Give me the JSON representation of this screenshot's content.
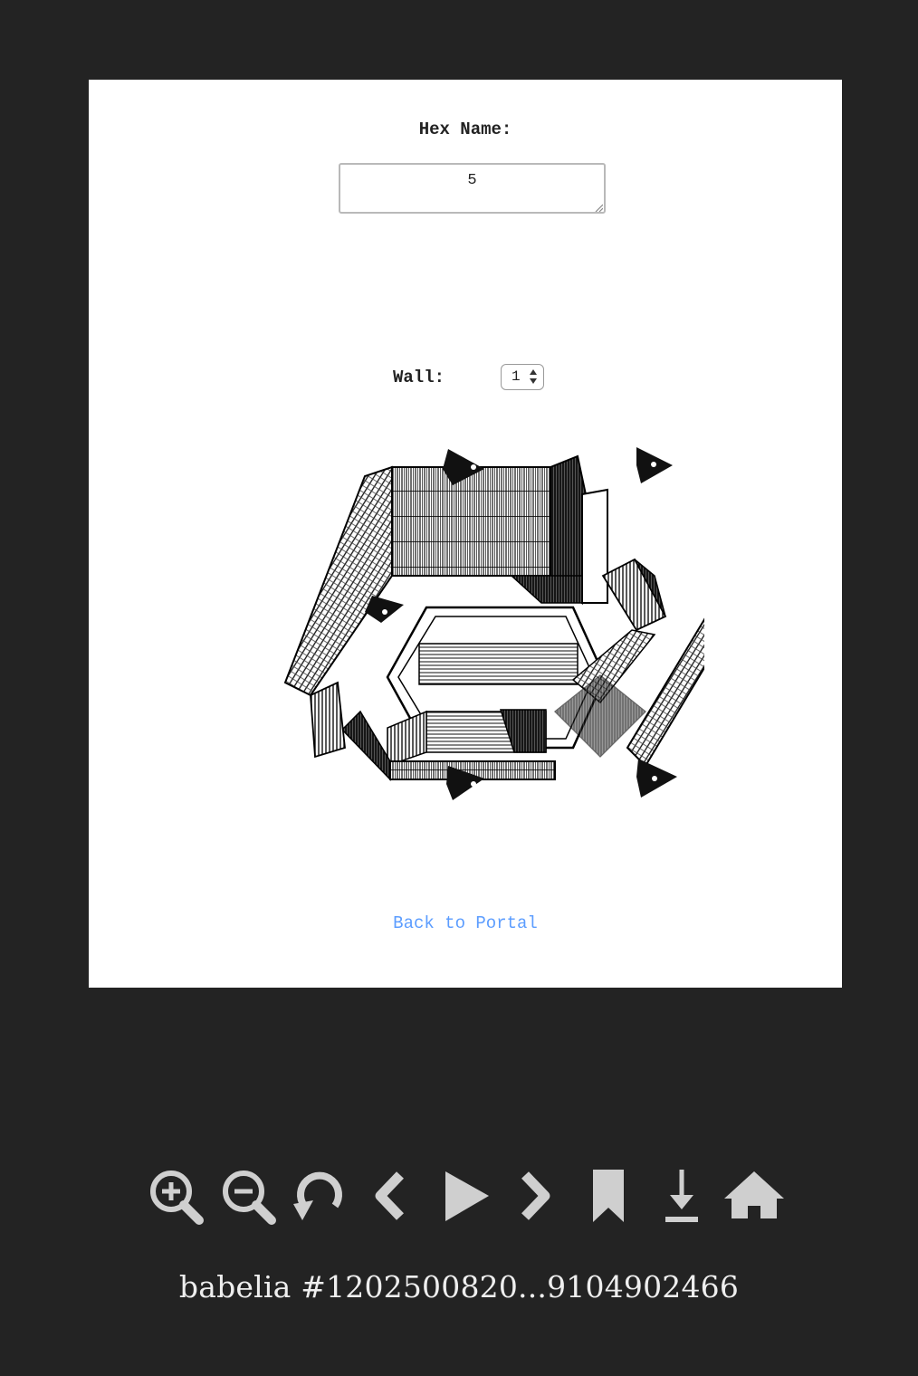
{
  "page": {
    "hex_label": "Hex Name:",
    "hex_value": "5",
    "wall_label": "Wall:",
    "wall_value": "1",
    "back_link": "Back to Portal"
  },
  "toolbar": {
    "icons": [
      "zoom-in-icon",
      "zoom-out-icon",
      "rotate-icon",
      "previous-icon",
      "play-icon",
      "next-icon",
      "bookmark-icon",
      "download-icon",
      "home-icon"
    ],
    "icon_color": "#cfcfcf"
  },
  "caption": "babelia #1202500820...9104902466",
  "colors": {
    "background": "#232323",
    "panel": "#ffffff",
    "link": "#5c9dff"
  }
}
